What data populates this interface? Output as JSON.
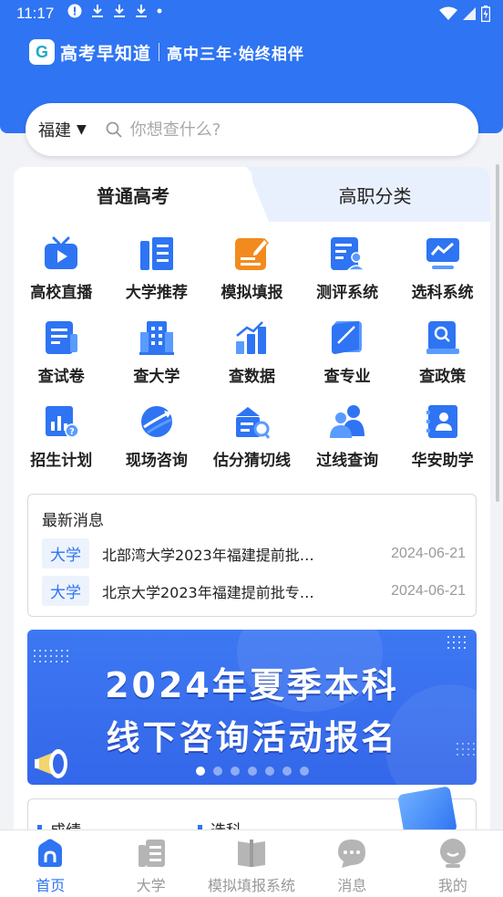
{
  "status_bar": {
    "time": "11:17"
  },
  "brand": {
    "name": "高考早知道",
    "slogan": "高中三年·始终相伴"
  },
  "search": {
    "region": "福建",
    "placeholder": "你想查什么?"
  },
  "tabs": [
    {
      "label": "普通高考",
      "active": true
    },
    {
      "label": "高职分类",
      "active": false
    }
  ],
  "grid": [
    [
      {
        "label": "高校直播",
        "icon": "tv-play-icon"
      },
      {
        "label": "大学推荐",
        "icon": "columns-icon"
      },
      {
        "label": "模拟填报",
        "icon": "edit-form-icon"
      },
      {
        "label": "测评系统",
        "icon": "assessment-icon"
      },
      {
        "label": "选科系统",
        "icon": "monitor-chart-icon"
      }
    ],
    [
      {
        "label": "查试卷",
        "icon": "exam-paper-icon"
      },
      {
        "label": "查大学",
        "icon": "building-icon"
      },
      {
        "label": "查数据",
        "icon": "bar-chart-icon"
      },
      {
        "label": "查专业",
        "icon": "major-book-icon"
      },
      {
        "label": "查政策",
        "icon": "policy-search-icon"
      }
    ],
    [
      {
        "label": "招生计划",
        "icon": "plan-chart-icon"
      },
      {
        "label": "现场咨询",
        "icon": "consult-globe-icon"
      },
      {
        "label": "估分猜切线",
        "icon": "score-estimate-icon"
      },
      {
        "label": "过线查询",
        "icon": "people-icon"
      },
      {
        "label": "华安助学",
        "icon": "contact-card-icon"
      }
    ]
  ],
  "news": {
    "title": "最新消息",
    "items": [
      {
        "tag": "大学",
        "text": "北部湾大学2023年福建提前批…",
        "date": "2024-06-21"
      },
      {
        "tag": "大学",
        "text": "北京大学2023年福建提前批专…",
        "date": "2024-06-21"
      }
    ]
  },
  "banner": {
    "line1": "2024年夏季本科",
    "line2": "线下咨询活动报名",
    "slide_count": 7,
    "active_slide": 1
  },
  "bottom_card": {
    "col1": "成绩",
    "col2": "选科"
  },
  "bottom_nav": [
    {
      "label": "首页",
      "icon": "home-icon",
      "active": true
    },
    {
      "label": "大学",
      "icon": "university-list-icon",
      "active": false
    },
    {
      "label": "模拟填报系统",
      "icon": "book-icon",
      "active": false
    },
    {
      "label": "消息",
      "icon": "chat-bubble-icon",
      "active": false
    },
    {
      "label": "我的",
      "icon": "user-icon",
      "active": false
    }
  ],
  "colors": {
    "primary": "#2e74f3",
    "orange": "#f28b1e",
    "background": "#f2f3f7"
  }
}
